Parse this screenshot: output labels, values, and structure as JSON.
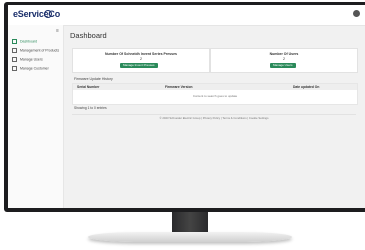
{
  "app": {
    "logo_text": "eServiceCo"
  },
  "sidebar": {
    "items": [
      {
        "label": "Dashboard"
      },
      {
        "label": "Management of Products"
      },
      {
        "label": "Manage Users"
      },
      {
        "label": "Manage Customer"
      }
    ]
  },
  "main": {
    "page_title": "Dashboard",
    "cards": [
      {
        "title": "Number Of Schneidh Invent Series Presses",
        "count": "2",
        "button_label": "Manage Invent Presses"
      },
      {
        "title": "Number Of Users",
        "count": "2",
        "button_label": "Manage Users"
      }
    ],
    "firmware": {
      "title": "Firmware Update History",
      "columns": [
        "Serial Number",
        "Firmware Version",
        "Date updated On"
      ],
      "empty_message": "Content to search goes to update",
      "showing_text": "Showing 1 to 0 entries"
    },
    "footer": "© 2023 Schneider Electric Group | Privacy Policy | Terms & Conditions | Cookie Settings"
  },
  "colors": {
    "accent": "#2a8a5a",
    "bezel": "#1d1d1f",
    "side_dot": "#1b3fa0"
  }
}
